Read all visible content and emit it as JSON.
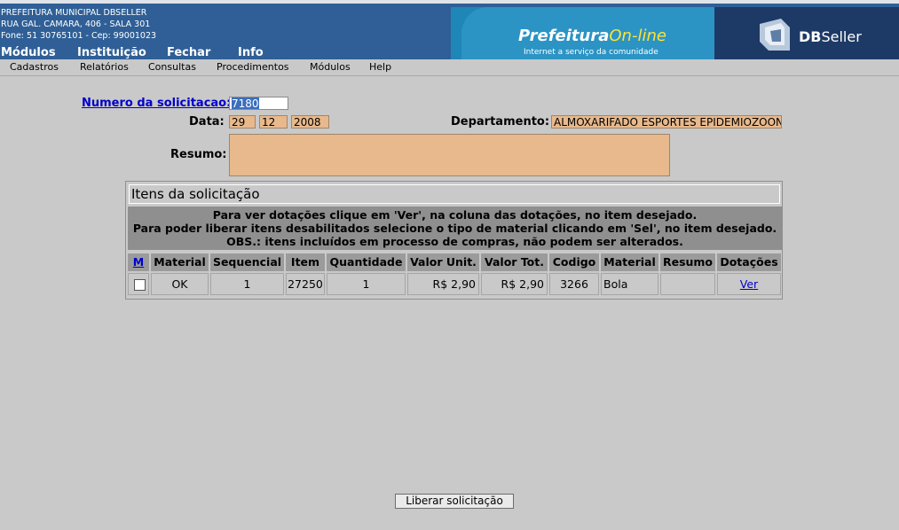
{
  "header": {
    "address_lines": [
      "PREFEITURA MUNICIPAL DBSELLER",
      "RUA GAL. CAMARA, 406 - SALA 301",
      "Fone: 51 30765101  -  Cep: 99001023"
    ],
    "nav": [
      "Módulos",
      "Instituição",
      "Fechar",
      "Info"
    ],
    "brand_main": "Prefeitura",
    "brand_accent": "On-line",
    "brand_tagline": "Internet a serviço da comunidade",
    "vendor_bold": "DB",
    "vendor_rest": "Seller"
  },
  "menu": [
    "Cadastros",
    "Relatórios",
    "Consultas",
    "Procedimentos",
    "Módulos",
    "Help"
  ],
  "form": {
    "numero_label": "Numero da solicitacao:",
    "numero_value": "7180",
    "data_label": "Data:",
    "data_day": "29",
    "data_month": "12",
    "data_year": "2008",
    "departamento_label": "Departamento:",
    "departamento_value": "ALMOXARIFADO ESPORTES EPIDEMIOZOON",
    "resumo_label": "Resumo:",
    "resumo_value": ""
  },
  "items": {
    "title": "Itens da solicitação",
    "notice": [
      "Para ver dotações clique em 'Ver', na coluna das dotações, no item desejado.",
      "Para poder liberar itens desabilitados selecione o tipo de material clicando em 'Sel', no item desejado.",
      "OBS.: itens incluídos em processo de compras, não podem ser alterados."
    ],
    "columns": [
      "M",
      "Material",
      "Sequencial",
      "Item",
      "Quantidade",
      "Valor Unit.",
      "Valor Tot.",
      "Codigo",
      "Material",
      "Resumo",
      "Dotações"
    ],
    "rows": [
      {
        "material": "OK",
        "sequencial": "1",
        "item": "27250",
        "quantidade": "1",
        "valor_unit": "R$ 2,90",
        "valor_tot": "R$ 2,90",
        "codigo": "3266",
        "material_desc": "Bola",
        "resumo": "",
        "dotacoes": "Ver",
        "checked": false
      }
    ]
  },
  "footer": {
    "liberar_button": "Liberar solicitação"
  },
  "colors": {
    "background": "#c9c9c9",
    "readonly_field": "#e8b98c",
    "header_blue": "#2f5f96",
    "link": "#0000cc"
  }
}
